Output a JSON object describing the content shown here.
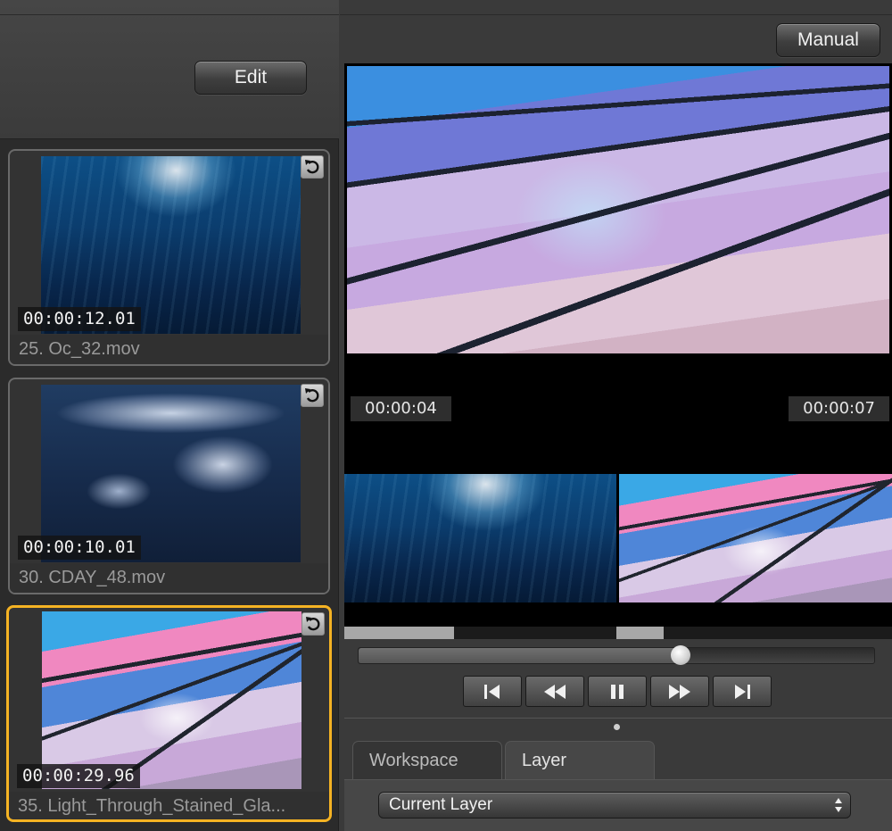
{
  "left_panel": {
    "edit_label": "Edit",
    "clips": [
      {
        "time": "00:00:12.01",
        "name": "25. Oc_32.mov",
        "thumb": "ocean-light-rays",
        "selected": false
      },
      {
        "time": "00:00:10.01",
        "name": "30. CDAY_48.mov",
        "thumb": "clouds",
        "selected": false
      },
      {
        "time": "00:00:29.96",
        "name": "35. Light_Through_Stained_Gla...",
        "thumb": "stained-glass",
        "selected": true
      }
    ]
  },
  "right_panel": {
    "manual_label": "Manual",
    "preview": {
      "timecode_left": "00:00:04",
      "timecode_right": "00:00:07"
    },
    "playback_position": 0.625,
    "transport": [
      "skip-to-start-icon",
      "rewind-icon",
      "pause-icon",
      "fast-forward-icon",
      "skip-to-end-icon"
    ],
    "tabs": [
      {
        "label": "Workspace",
        "active": false
      },
      {
        "label": "Layer",
        "active": true
      }
    ],
    "layer_select": {
      "value": "Current Layer"
    }
  },
  "colors": {
    "selection": "#f5b323",
    "panel_bg": "#3a3a3a",
    "sidebar_bg": "#2b2b2b"
  }
}
